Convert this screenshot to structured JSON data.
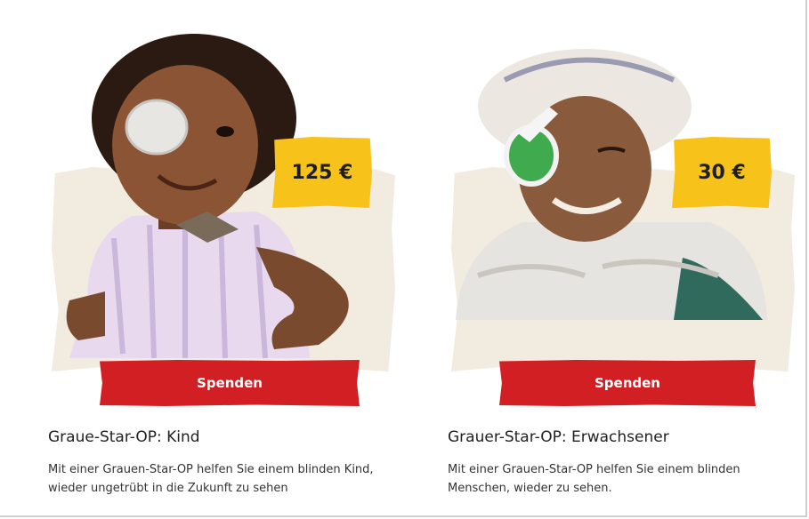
{
  "colors": {
    "accent_red": "#d21f24",
    "price_yellow": "#f7c21a",
    "paper_beige": "#f1ebe0"
  },
  "cards": [
    {
      "price": "125 €",
      "button_label": "Spenden",
      "title": "Graue-Star-OP: Kind",
      "description": "Mit einer Grauen-Star-OP helfen Sie einem blinden Kind, wieder ungetrübt in die Zukunft zu sehen"
    },
    {
      "price": "30 €",
      "button_label": "Spenden",
      "title": "Grauer-Star-OP: Erwachsener",
      "description": "Mit einer Grauen-Star-OP helfen Sie einem blinden Menschen, wieder zu sehen."
    }
  ]
}
